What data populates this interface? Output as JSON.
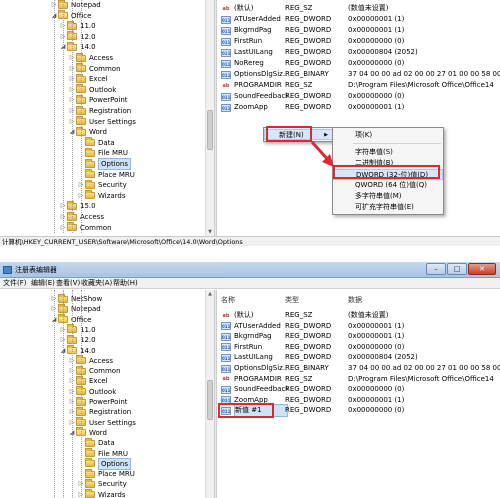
{
  "shot1": {
    "tree": [
      {
        "label": "Notepad",
        "level": 4,
        "expand": "closed"
      },
      {
        "label": "Office",
        "level": 4,
        "expand": "open"
      },
      {
        "label": "11.0",
        "level": 5,
        "expand": "closed"
      },
      {
        "label": "12.0",
        "level": 5,
        "expand": "closed"
      },
      {
        "label": "14.0",
        "level": 5,
        "expand": "open"
      },
      {
        "label": "Access",
        "level": 6,
        "expand": "closed"
      },
      {
        "label": "Common",
        "level": 6,
        "expand": "closed"
      },
      {
        "label": "Excel",
        "level": 6,
        "expand": "closed"
      },
      {
        "label": "Outlook",
        "level": 6,
        "expand": "closed"
      },
      {
        "label": "PowerPoint",
        "level": 6,
        "expand": "closed"
      },
      {
        "label": "Registration",
        "level": 6,
        "expand": "closed"
      },
      {
        "label": "User Settings",
        "level": 6,
        "expand": "closed"
      },
      {
        "label": "Word",
        "level": 6,
        "expand": "open"
      },
      {
        "label": "Data",
        "level": 7,
        "expand": "none"
      },
      {
        "label": "File MRU",
        "level": 7,
        "expand": "none"
      },
      {
        "label": "Options",
        "level": 7,
        "expand": "none",
        "selected": true
      },
      {
        "label": "Place MRU",
        "level": 7,
        "expand": "none"
      },
      {
        "label": "Security",
        "level": 7,
        "expand": "closed"
      },
      {
        "label": "Wizards",
        "level": 7,
        "expand": "closed"
      },
      {
        "label": "15.0",
        "level": 5,
        "expand": "closed"
      },
      {
        "label": "Access",
        "level": 5,
        "expand": "closed"
      },
      {
        "label": "Common",
        "level": 5,
        "expand": "closed"
      }
    ],
    "values": [
      {
        "icon": "ab",
        "name": "(默认)",
        "type": "REG_SZ",
        "data": "(数值未设置)"
      },
      {
        "icon": "bin",
        "name": "ATUserAdded",
        "type": "REG_DWORD",
        "data": "0x00000001 (1)"
      },
      {
        "icon": "bin",
        "name": "BkgrndPag",
        "type": "REG_DWORD",
        "data": "0x00000001 (1)"
      },
      {
        "icon": "bin",
        "name": "FirstRun",
        "type": "REG_DWORD",
        "data": "0x00000000 (0)"
      },
      {
        "icon": "bin",
        "name": "LastUILang",
        "type": "REG_DWORD",
        "data": "0x00000804 (2052)"
      },
      {
        "icon": "bin",
        "name": "NoRereg",
        "type": "REG_DWORD",
        "data": "0x00000000 (0)"
      },
      {
        "icon": "bin",
        "name": "OptionsDlgSiz...",
        "type": "REG_BINARY",
        "data": "37 04 00 00 ad 02 00 00 27 01 00 00 58 00"
      },
      {
        "icon": "ab",
        "name": "PROGRAMDIR",
        "type": "REG_SZ",
        "data": "D:\\Program Files\\Microsoft Office\\Office14"
      },
      {
        "icon": "bin",
        "name": "SoundFeedback",
        "type": "REG_DWORD",
        "data": "0x00000000 (0)"
      },
      {
        "icon": "bin",
        "name": "ZoomApp",
        "type": "REG_DWORD",
        "data": "0x00000001 (1)"
      }
    ],
    "context_menu": {
      "new_label": "新建(N)"
    },
    "submenu": [
      {
        "label": "项(K)"
      },
      {
        "sep": true
      },
      {
        "label": "字符串值(S)"
      },
      {
        "label": "二进制值(B)"
      },
      {
        "label": "DWORD (32-位)值(D)",
        "highlight": true
      },
      {
        "label": "QWORD (64 位)值(Q)"
      },
      {
        "label": "多字符串值(M)"
      },
      {
        "label": "可扩充字符串值(E)"
      }
    ],
    "status_path": "计算机\\HKEY_CURRENT_USER\\Software\\Microsoft\\Office\\14.0\\Word\\Options"
  },
  "shot2": {
    "title": "注册表编辑器",
    "menus": [
      "文件(F)",
      "编辑(E)",
      "查看(V)",
      "收藏夹(A)",
      "帮助(H)"
    ],
    "window_buttons": {
      "minimize": "–",
      "maximize": "□",
      "close": "✕"
    },
    "headers": {
      "name": "名称",
      "type": "类型",
      "data": "数据"
    },
    "tree": [
      {
        "label": "NetShow",
        "level": 4,
        "expand": "closed"
      },
      {
        "label": "Notepad",
        "level": 4,
        "expand": "closed"
      },
      {
        "label": "Office",
        "level": 4,
        "expand": "open"
      },
      {
        "label": "11.0",
        "level": 5,
        "expand": "closed"
      },
      {
        "label": "12.0",
        "level": 5,
        "expand": "closed"
      },
      {
        "label": "14.0",
        "level": 5,
        "expand": "open"
      },
      {
        "label": "Access",
        "level": 6,
        "expand": "closed"
      },
      {
        "label": "Common",
        "level": 6,
        "expand": "closed"
      },
      {
        "label": "Excel",
        "level": 6,
        "expand": "closed"
      },
      {
        "label": "Outlook",
        "level": 6,
        "expand": "closed"
      },
      {
        "label": "PowerPoint",
        "level": 6,
        "expand": "closed"
      },
      {
        "label": "Registration",
        "level": 6,
        "expand": "closed"
      },
      {
        "label": "User Settings",
        "level": 6,
        "expand": "closed"
      },
      {
        "label": "Word",
        "level": 6,
        "expand": "open"
      },
      {
        "label": "Data",
        "level": 7,
        "expand": "none"
      },
      {
        "label": "File MRU",
        "level": 7,
        "expand": "none"
      },
      {
        "label": "Options",
        "level": 7,
        "expand": "none",
        "selected": true
      },
      {
        "label": "Place MRU",
        "level": 7,
        "expand": "none"
      },
      {
        "label": "Security",
        "level": 7,
        "expand": "closed"
      },
      {
        "label": "Wizards",
        "level": 7,
        "expand": "closed"
      }
    ],
    "values": [
      {
        "icon": "ab",
        "name": "(默认)",
        "type": "REG_SZ",
        "data": "(数值未设置)"
      },
      {
        "icon": "bin",
        "name": "ATUserAdded",
        "type": "REG_DWORD",
        "data": "0x00000001 (1)"
      },
      {
        "icon": "bin",
        "name": "BkgrndPag",
        "type": "REG_DWORD",
        "data": "0x00000001 (1)"
      },
      {
        "icon": "bin",
        "name": "FirstRun",
        "type": "REG_DWORD",
        "data": "0x00000000 (0)"
      },
      {
        "icon": "bin",
        "name": "LastUILang",
        "type": "REG_DWORD",
        "data": "0x00000804 (2052)"
      },
      {
        "icon": "bin",
        "name": "OptionsDlgSiz...",
        "type": "REG_BINARY",
        "data": "37 04 00 00 ad 02 00 00 27 01 00 00 58 00"
      },
      {
        "icon": "ab",
        "name": "PROGRAMDIR",
        "type": "REG_SZ",
        "data": "D:\\Program Files\\Microsoft Office\\Office14"
      },
      {
        "icon": "bin",
        "name": "SoundFeedback",
        "type": "REG_DWORD",
        "data": "0x00000000 (0)"
      },
      {
        "icon": "bin",
        "name": "ZoomApp",
        "type": "REG_DWORD",
        "data": "0x00000001 (1)"
      },
      {
        "icon": "bin",
        "name": "新值 #1",
        "type": "REG_DWORD",
        "data": "0x00000000 (0)",
        "selected": true
      }
    ]
  },
  "colors": {
    "highlight_box": "#e0262e",
    "selection": "#cde3f8"
  }
}
